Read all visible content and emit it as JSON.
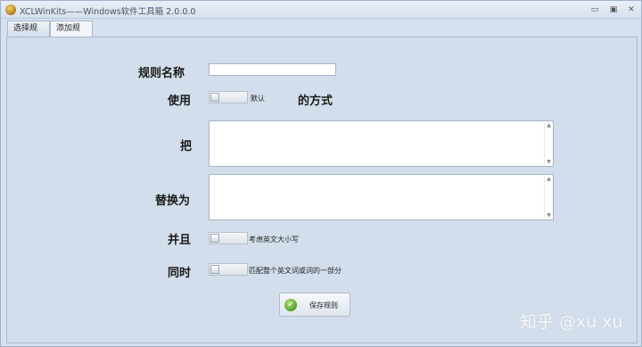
{
  "window": {
    "title": "XCLWinKits——Windows软件工具箱 2.0.0.0",
    "controls": {
      "minimize": "▭",
      "maximize": "▣",
      "close": "✕"
    }
  },
  "tabs": [
    {
      "label": "选择规则"
    },
    {
      "label": "添加规则",
      "selected": true
    }
  ],
  "form": {
    "rule_name_label": "规则名称",
    "rule_name_value": "",
    "use_label": "使用",
    "use_toggle_text": "默认",
    "use_suffix": "的方式",
    "replace_from_label": "把",
    "replace_to_label": "替换为",
    "and_label": "并且",
    "case_toggle_text": "考虑英文大小写",
    "simultaneous_label": "同时",
    "match_toggle_text": "匹配整个英文词或词的一部分",
    "save_button_label": "保存规则"
  },
  "watermark": "知乎 @xu xu"
}
